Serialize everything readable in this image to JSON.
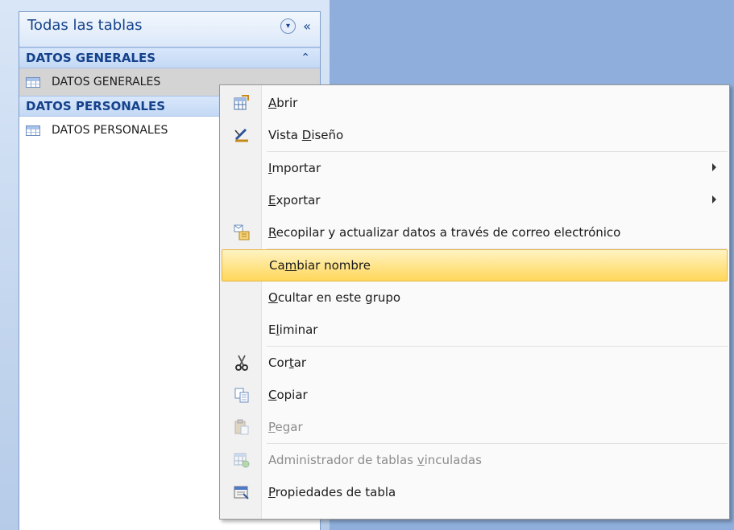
{
  "nav": {
    "title": "Todas las tablas",
    "dropdown_glyph": "▾",
    "collapse_glyph": "«",
    "groups": [
      {
        "label": "DATOS GENERALES",
        "toggle_glyph": "⌃",
        "item": "DATOS GENERALES"
      },
      {
        "label": "DATOS PERSONALES",
        "item": "DATOS PERSONALES"
      }
    ]
  },
  "context_menu": {
    "items": [
      {
        "name": "abrir",
        "pre": "",
        "acc": "A",
        "post": "brir",
        "icon": "open-table-icon"
      },
      {
        "name": "vista-diseno",
        "pre": "Vista ",
        "acc": "D",
        "post": "iseño",
        "icon": "design-view-icon"
      },
      {
        "name": "importar",
        "pre": "",
        "acc": "I",
        "post": "mportar",
        "submenu": true
      },
      {
        "name": "exportar",
        "pre": "",
        "acc": "E",
        "post": "xportar",
        "submenu": true
      },
      {
        "name": "recopilar",
        "pre": "",
        "acc": "R",
        "post": "ecopilar y actualizar datos a través de correo electrónico",
        "icon": "collect-data-icon"
      },
      {
        "name": "cambiar-nombre",
        "pre": "Ca",
        "acc": "m",
        "post": "biar nombre",
        "highlighted": true
      },
      {
        "name": "ocultar",
        "pre": "",
        "acc": "O",
        "post": "cultar en este grupo"
      },
      {
        "name": "eliminar",
        "pre": "E",
        "acc": "l",
        "post": "iminar"
      },
      {
        "name": "cortar",
        "pre": "Cor",
        "acc": "t",
        "post": "ar",
        "icon": "scissors-icon"
      },
      {
        "name": "copiar",
        "pre": "",
        "acc": "C",
        "post": "opiar",
        "icon": "copy-icon"
      },
      {
        "name": "pegar",
        "pre": "",
        "acc": "P",
        "post": "egar",
        "icon": "paste-icon",
        "disabled": true
      },
      {
        "name": "administrador",
        "pre": "Administrador de tablas ",
        "acc": "v",
        "post": "inculadas",
        "icon": "linked-table-manager-icon",
        "disabled": true
      },
      {
        "name": "propiedades",
        "pre": "",
        "acc": "P",
        "post": "ropiedades de tabla",
        "icon": "table-properties-icon"
      }
    ]
  },
  "colors": {
    "highlight": "#ffd75a",
    "nav_text": "#15428b",
    "workspace": "#8faedb"
  }
}
